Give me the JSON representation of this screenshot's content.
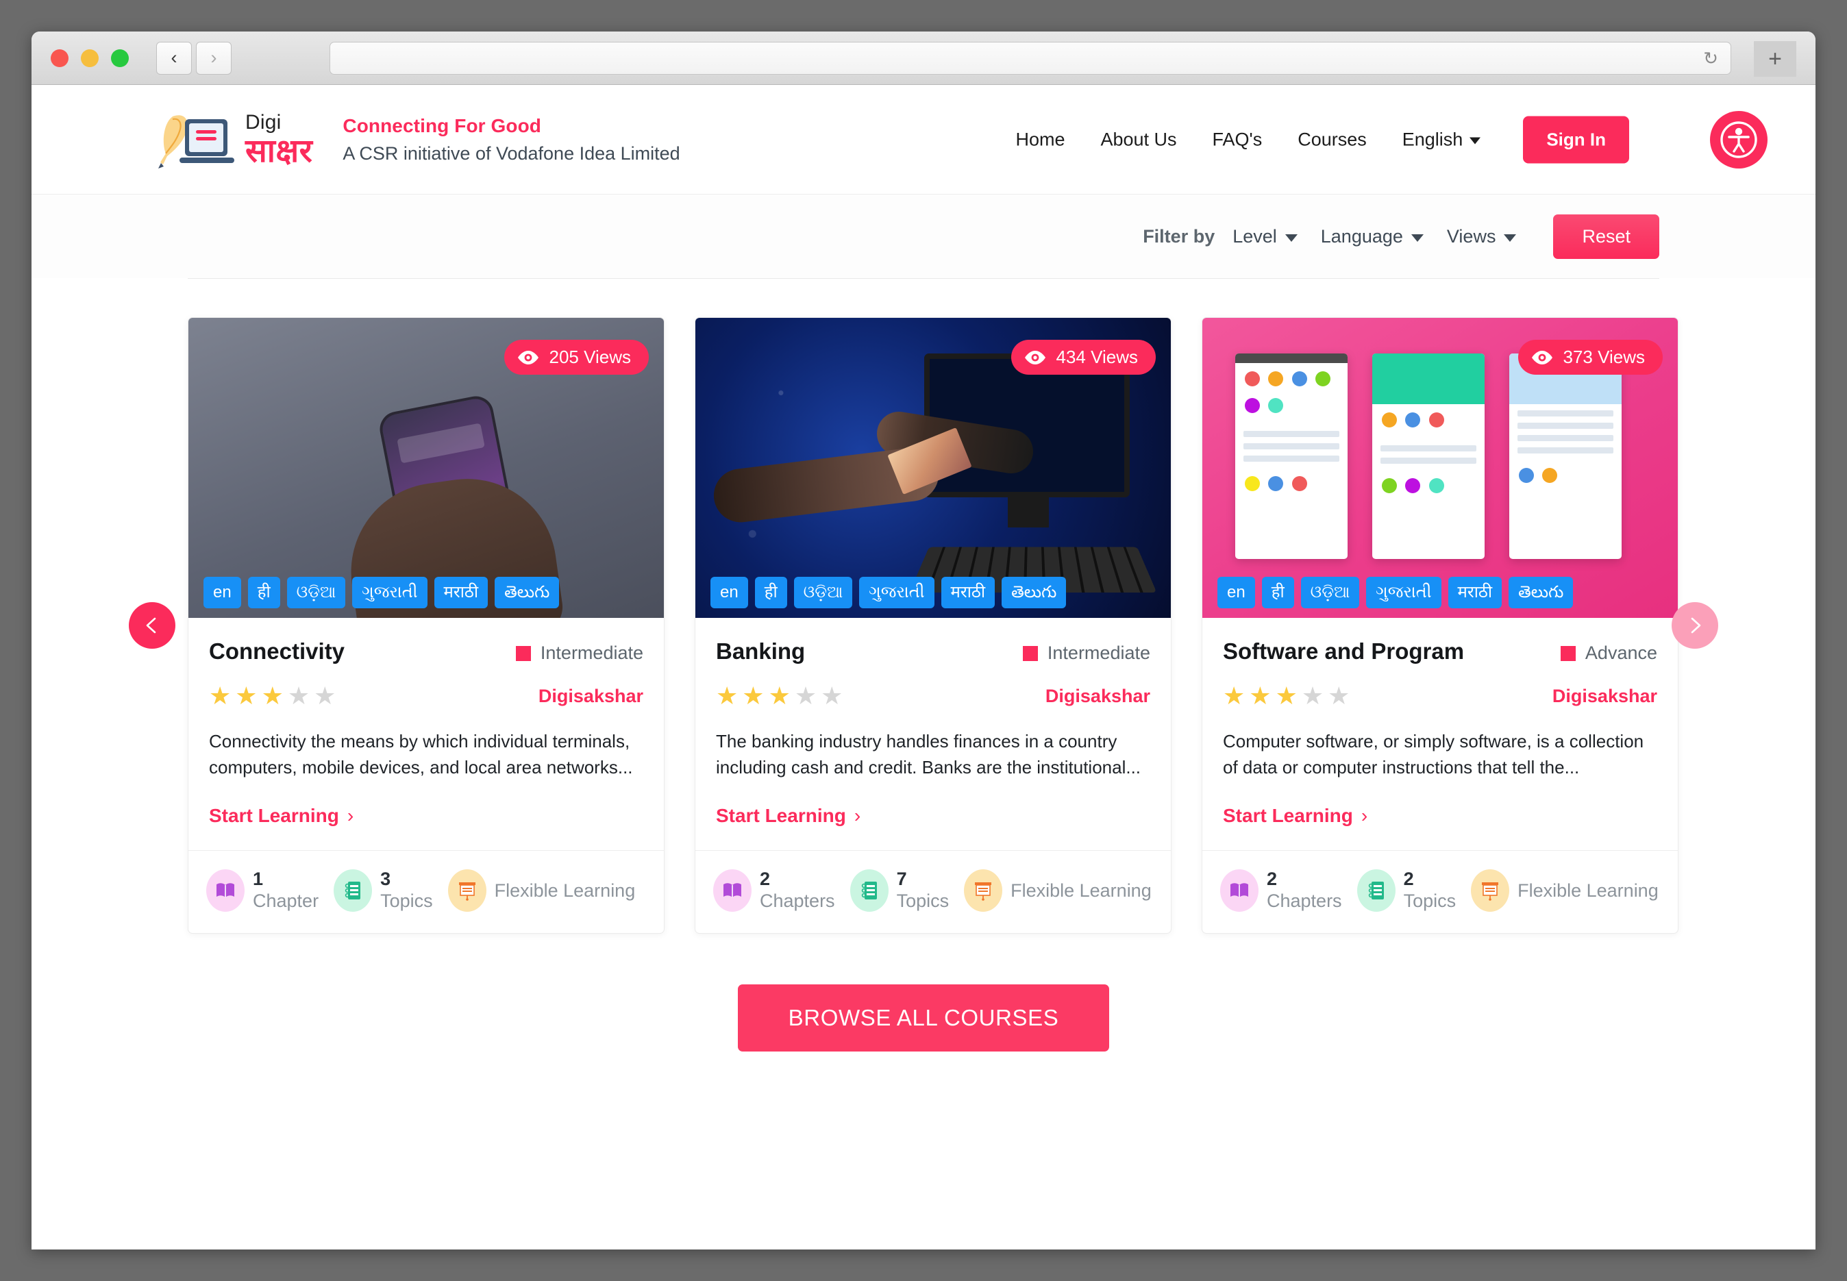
{
  "browser": {
    "traffic_lights": [
      "close",
      "minimize",
      "maximize"
    ],
    "back_label": "‹",
    "forward_label": "›",
    "url_value": "",
    "reload_label": "↻",
    "new_tab_label": "+"
  },
  "header": {
    "logo": {
      "word_top": "Digi",
      "word_bottom": "साक्षर"
    },
    "tagline_title": "Connecting For Good",
    "tagline_sub": "A CSR initiative of Vodafone Idea Limited",
    "nav": [
      {
        "label": "Home"
      },
      {
        "label": "About Us"
      },
      {
        "label": "FAQ's"
      },
      {
        "label": "Courses"
      }
    ],
    "language_selected": "English",
    "sign_in_label": "Sign In",
    "accessibility_icon": "accessibility-icon"
  },
  "filters": {
    "filter_by_label": "Filter by",
    "dropdowns": [
      {
        "label": "Level"
      },
      {
        "label": "Language"
      },
      {
        "label": "Views"
      }
    ],
    "reset_label": "Reset"
  },
  "carousel": {
    "prev_label": "‹",
    "next_label": "›",
    "cards": [
      {
        "title": "Connectivity",
        "views": "205 Views",
        "level": "Intermediate",
        "author": "Digisakshar",
        "rating": 3,
        "rating_max": 5,
        "description": "Connectivity the means by which individual terminals, computers, mobile devices, and local area networks...",
        "cta": "Start Learning",
        "languages": [
          "en",
          "ही",
          "ଓଡ଼ିଆ",
          "ગુજરાતી",
          "मराठी",
          "తెలుగు"
        ],
        "stats": [
          {
            "num": "1",
            "label": "Chapter"
          },
          {
            "num": "3",
            "label": "Topics"
          },
          {
            "num": "",
            "label": "Flexible Learning"
          }
        ]
      },
      {
        "title": "Banking",
        "views": "434 Views",
        "level": "Intermediate",
        "author": "Digisakshar",
        "rating": 3,
        "rating_max": 5,
        "description": "The banking industry handles finances in a country including cash and credit. Banks are the institutional...",
        "cta": "Start Learning",
        "languages": [
          "en",
          "ही",
          "ଓଡ଼ିଆ",
          "ગુજરાતી",
          "मराठी",
          "తెలుగు"
        ],
        "stats": [
          {
            "num": "2",
            "label": "Chapters"
          },
          {
            "num": "7",
            "label": "Topics"
          },
          {
            "num": "",
            "label": "Flexible Learning"
          }
        ]
      },
      {
        "title": "Software and Program",
        "views": "373 Views",
        "level": "Advance",
        "author": "Digisakshar",
        "rating": 3,
        "rating_max": 5,
        "description": "Computer software, or simply software, is a collection of data or computer instructions that tell the...",
        "cta": "Start Learning",
        "languages": [
          "en",
          "ही",
          "ଓଡ଼ିଆ",
          "ગુજરાતી",
          "मराठी",
          "తెలుగు"
        ],
        "stats": [
          {
            "num": "2",
            "label": "Chapters"
          },
          {
            "num": "2",
            "label": "Topics"
          },
          {
            "num": "",
            "label": "Flexible Learning"
          }
        ]
      }
    ]
  },
  "browse_all_label": "BROWSE ALL COURSES",
  "colors": {
    "brand_pink": "#fb2b5b",
    "language_tag_blue": "#1790f6",
    "star_gold": "#fbc93d",
    "muted_text": "#8d949b"
  }
}
